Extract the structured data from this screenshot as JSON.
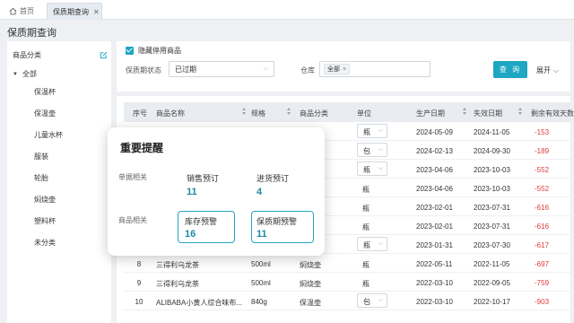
{
  "tabs": {
    "home_label": "首页",
    "active_label": "保质期查询",
    "close_glyph": "✕"
  },
  "page": {
    "title": "保质期查询"
  },
  "left_panel": {
    "header_label": "商品分类",
    "edit_icon": "edit-icon",
    "root_label": "全部",
    "items": [
      "保温杯",
      "保温壶",
      "儿童水杯",
      "服装",
      "轮胎",
      "焖烧壶",
      "塑料杯",
      "未分类"
    ]
  },
  "filter": {
    "hide_disabled_label": "隐藏停用商品",
    "hide_disabled_checked": true,
    "status_label": "保质期状态",
    "status_value": "已过期",
    "warehouse_label": "仓库",
    "warehouse_tag": "全部",
    "query_button": "查 询",
    "expand_label": "展开"
  },
  "table": {
    "headers": {
      "index": "序号",
      "name": "商品名称",
      "spec": "规格",
      "category": "商品分类",
      "unit": "单位",
      "prod_date": "生产日期",
      "exp_date": "失效日期",
      "remaining": "剩余有效天数"
    },
    "rows": [
      {
        "index": "",
        "name": "",
        "spec": "",
        "category": "",
        "unit": "瓶",
        "unit_select": true,
        "prod_date": "2024-05-09",
        "exp_date": "2024-11-05",
        "remaining": "-153"
      },
      {
        "index": "",
        "name": "",
        "spec": "",
        "category": "",
        "unit": "包",
        "unit_select": true,
        "prod_date": "2024-02-13",
        "exp_date": "2024-09-30",
        "remaining": "-189"
      },
      {
        "index": "",
        "name": "",
        "spec": "",
        "category": "",
        "unit": "瓶",
        "unit_select": true,
        "prod_date": "2023-04-06",
        "exp_date": "2023-10-03",
        "remaining": "-552"
      },
      {
        "index": "",
        "name": "",
        "spec": "",
        "category": "",
        "unit": "瓶",
        "unit_select": false,
        "prod_date": "2023-04-06",
        "exp_date": "2023-10-03",
        "remaining": "-552"
      },
      {
        "index": "",
        "name": "",
        "spec": "",
        "category": "",
        "unit": "瓶",
        "unit_select": false,
        "prod_date": "2023-02-01",
        "exp_date": "2023-07-31",
        "remaining": "-616"
      },
      {
        "index": "",
        "name": "",
        "spec": "",
        "category": "",
        "unit": "瓶",
        "unit_select": false,
        "prod_date": "2023-02-01",
        "exp_date": "2023-07-31",
        "remaining": "-616"
      },
      {
        "index": "",
        "name": "",
        "spec": "",
        "category": "",
        "unit": "瓶",
        "unit_select": true,
        "prod_date": "2023-01-31",
        "exp_date": "2023-07-30",
        "remaining": "-617"
      },
      {
        "index": "8",
        "name": "三得利乌龙茶",
        "spec": "500ml",
        "category": "焖烧壶",
        "unit": "瓶",
        "unit_select": false,
        "prod_date": "2022-05-11",
        "exp_date": "2022-11-05",
        "remaining": "-697"
      },
      {
        "index": "9",
        "name": "三得利乌龙茶",
        "spec": "500ml",
        "category": "焖烧壶",
        "unit": "瓶",
        "unit_select": false,
        "prod_date": "2022-03-10",
        "exp_date": "2022-09-05",
        "remaining": "-759"
      },
      {
        "index": "10",
        "name": "ALIBABA小黄人综合味布...",
        "spec": "840g",
        "category": "保温壶",
        "unit": "包",
        "unit_select": true,
        "prod_date": "2022-03-10",
        "exp_date": "2022-10-17",
        "remaining": "-903"
      }
    ]
  },
  "popup": {
    "title": "重要提醒",
    "order_section": "单据相关",
    "sales_order_label": "销售预订",
    "sales_order_count": "11",
    "purchase_order_label": "进货预订",
    "purchase_order_count": "4",
    "goods_section": "商品相关",
    "stock_warning_label": "库存预警",
    "stock_warning_count": "16",
    "shelf_warning_label": "保质期预警",
    "shelf_warning_count": "11"
  },
  "colors": {
    "accent": "#1fa6c3",
    "danger": "#e03a3a",
    "count_text": "#1a8aa6"
  }
}
